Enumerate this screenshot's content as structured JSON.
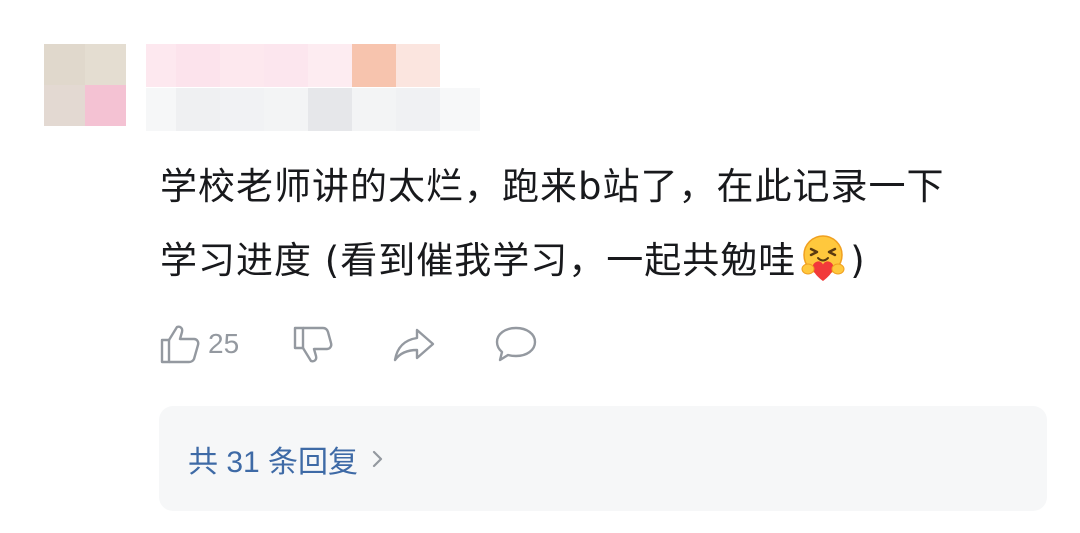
{
  "comment": {
    "text_line1": "学校老师讲的太烂，跑来b站了，在此记录一下",
    "text_line2_before_emoji": "学习进度 (看到催我学习，一起共勉哇",
    "emoji": "hug-emoji",
    "text_line2_after_emoji": ")"
  },
  "actions": {
    "like_count": "25",
    "like_icon": "thumbs-up-icon",
    "dislike_icon": "thumbs-down-icon",
    "share_icon": "share-icon",
    "reply_icon": "comment-bubble-icon"
  },
  "replies": {
    "label": "共 31 条回复",
    "icon": "chevron-right-icon"
  },
  "colors": {
    "text": "#18191c",
    "muted": "#9499a0",
    "link": "#3e6aa6",
    "reply_bg": "#f6f7f8"
  }
}
